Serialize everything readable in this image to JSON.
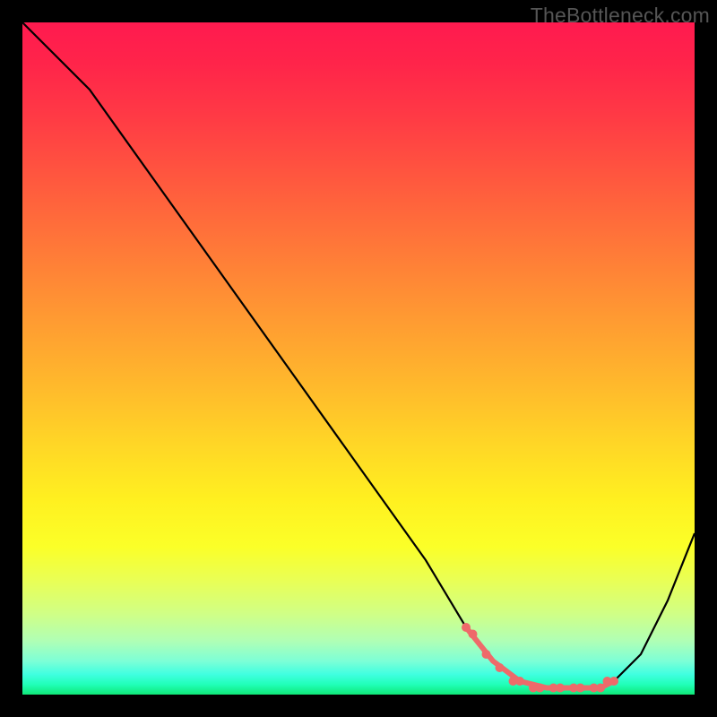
{
  "watermark": "TheBottleneck.com",
  "chart_data": {
    "type": "line",
    "title": "",
    "xlabel": "",
    "ylabel": "",
    "xlim": [
      0,
      100
    ],
    "ylim": [
      0,
      100
    ],
    "grid": false,
    "series": [
      {
        "name": "curve",
        "color": "#000000",
        "x": [
          0,
          4,
          10,
          20,
          30,
          40,
          50,
          60,
          66,
          70,
          74,
          78,
          82,
          86,
          88,
          92,
          96,
          100
        ],
        "y": [
          100,
          96,
          90,
          76,
          62,
          48,
          34,
          20,
          10,
          5,
          2,
          1,
          1,
          1,
          2,
          6,
          14,
          24
        ]
      }
    ],
    "highlight_segment": {
      "name": "minimum-band",
      "color": "#ee6a6a",
      "x": [
        66,
        70,
        74,
        78,
        82,
        86,
        88
      ],
      "y": [
        10,
        5,
        2,
        1,
        1,
        1,
        2
      ]
    },
    "highlight_points": {
      "name": "minimum-dots",
      "color": "#ee6a6a",
      "x": [
        66,
        67,
        69,
        71,
        73,
        74,
        76,
        77,
        79,
        80,
        82,
        83,
        85,
        86,
        87,
        88
      ],
      "y": [
        10,
        9,
        6,
        4,
        2,
        2,
        1,
        1,
        1,
        1,
        1,
        1,
        1,
        1,
        2,
        2
      ]
    }
  }
}
